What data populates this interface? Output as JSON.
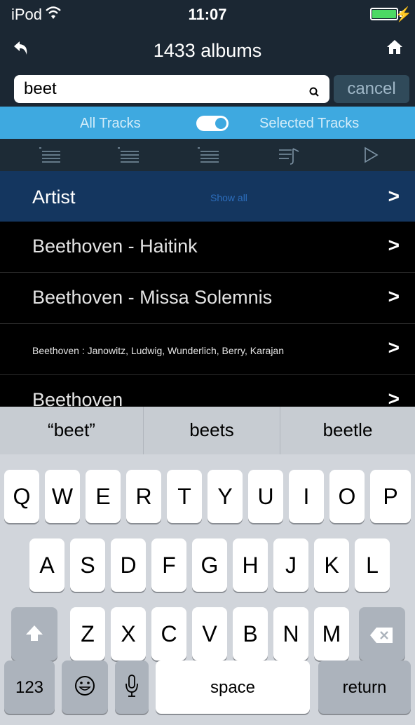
{
  "status_bar": {
    "carrier": "iPod",
    "time": "11:07"
  },
  "navbar": {
    "title": "1433 albums",
    "back_icon": "back-arrow-icon",
    "home_icon": "home-icon"
  },
  "search": {
    "value": "beet",
    "cancel_label": "cancel"
  },
  "track_toggle": {
    "left_label": "All Tracks",
    "right_label": "Selected Tracks",
    "state": "on"
  },
  "toolbar": {
    "icons": [
      "list-top-icon",
      "list-middle-icon",
      "list-bottom-icon",
      "playlist-add-icon",
      "play-icon"
    ]
  },
  "section": {
    "label": "Artist",
    "show_all": "Show all"
  },
  "results": [
    "Beethoven - Haitink",
    "Beethoven - Missa Solemnis",
    "Beethoven : Janowitz, Ludwig, Wunderlich, Berry, Karajan",
    "Beethoven"
  ],
  "suggestions": [
    "“beet”",
    "beets",
    "beetle"
  ],
  "keyboard": {
    "row1": [
      "Q",
      "W",
      "E",
      "R",
      "T",
      "Y",
      "U",
      "I",
      "O",
      "P"
    ],
    "row2": [
      "A",
      "S",
      "D",
      "F",
      "G",
      "H",
      "J",
      "K",
      "L"
    ],
    "row3": [
      "Z",
      "X",
      "C",
      "V",
      "B",
      "N",
      "M"
    ],
    "numbers_label": "123",
    "space_label": "space",
    "return_label": "return"
  },
  "colors": {
    "accent": "#3ea9e0",
    "header": "#14365f",
    "bar": "#1b2733",
    "battery": "#4cd964"
  }
}
